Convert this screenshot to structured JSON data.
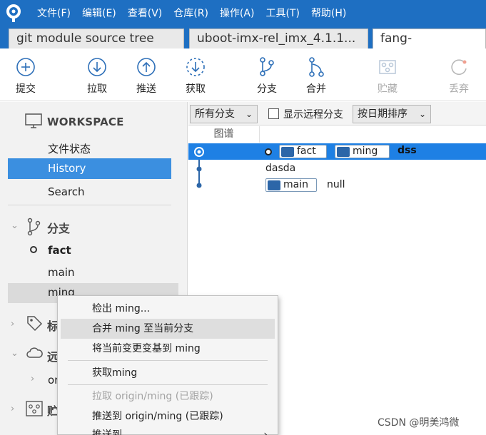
{
  "menu": [
    "文件(F)",
    "编辑(E)",
    "查看(V)",
    "仓库(R)",
    "操作(A)",
    "工具(T)",
    "帮助(H)"
  ],
  "tabs": [
    "git module source tree",
    "uboot-imx-rel_imx_4.1.1...",
    "fang-"
  ],
  "toolbar": {
    "commit": "提交",
    "pull": "拉取",
    "push": "推送",
    "fetch": "获取",
    "branch": "分支",
    "merge": "合并",
    "stash": "贮藏",
    "discard": "丢弃"
  },
  "sidebar": {
    "workspace_title": "WORKSPACE",
    "workspace_items": [
      "文件状态",
      "History",
      "Search"
    ],
    "branches_title": "分支",
    "branches": [
      "fact",
      "main",
      "ming"
    ],
    "tags_title": "标",
    "remotes_title": "远",
    "remote_item": "or",
    "stashes_title": "贮"
  },
  "filter": {
    "all_branches": "所有分支",
    "show_remote": "显示远程分支",
    "sort": "按日期排序"
  },
  "graph_header": "图谱",
  "commits": [
    {
      "tags": [
        "fact",
        "ming"
      ],
      "message": "dss"
    },
    {
      "message": "dasda"
    },
    {
      "tags": [
        "main"
      ],
      "message": "null"
    }
  ],
  "context_menu": {
    "checkout": "检出 ming...",
    "merge": "合并 ming 至当前分支",
    "rebase": "将当前变更变基到 ming",
    "fetch": "获取ming",
    "pull": "拉取 origin/ming (已跟踪)",
    "push_to": "推送到 origin/ming (已跟踪)",
    "push_submenu": "推送到"
  },
  "watermark": "CSDN @明美鸿微",
  "colors": {
    "titlebar": "#1e6fc2",
    "selection": "#3b8fe0",
    "row_selected": "#1e80e4",
    "tag_icon": "#2c66a8"
  }
}
